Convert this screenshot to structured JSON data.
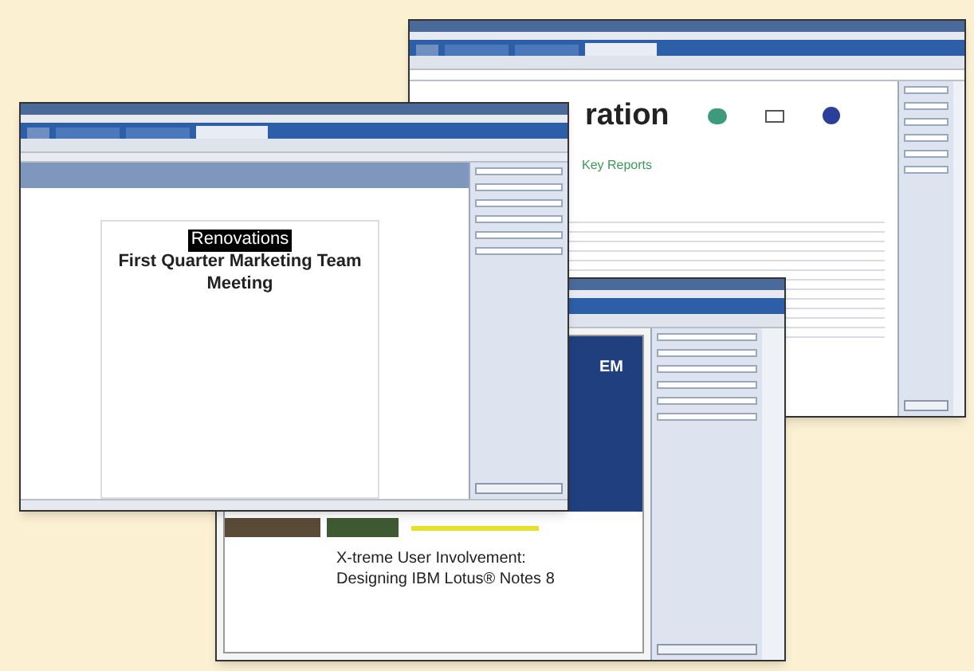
{
  "windows": [
    {
      "kind": "spreadsheet",
      "heading": "ration",
      "subheading": "Key Reports"
    },
    {
      "kind": "presentation",
      "logo": "EM",
      "title_lines": [
        "X-treme User Involvement:",
        "Designing IBM Lotus® Notes 8"
      ]
    },
    {
      "kind": "document",
      "highlight": "Renovations",
      "title_lines": [
        "First Quarter Marketing Team",
        "Meeting"
      ]
    }
  ]
}
